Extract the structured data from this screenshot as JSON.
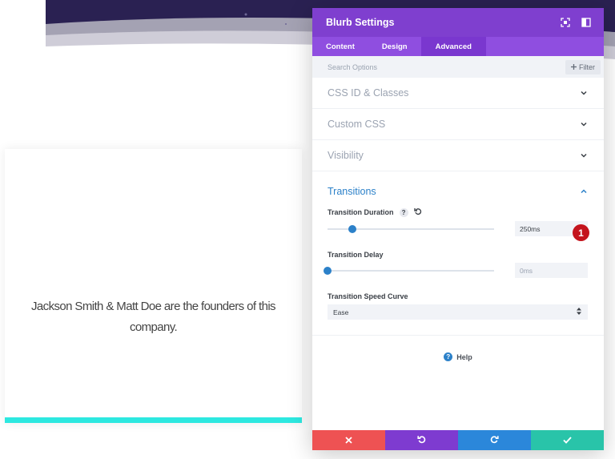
{
  "colors": {
    "header": "#7f3fcf",
    "tab_bar": "#8f4ee0",
    "tab_active": "#7a37cf",
    "accent_blue": "#2c81c9",
    "badge_red": "#c4141d",
    "footer_cancel": "#ee5253",
    "footer_undo": "#7e3bd0",
    "footer_redo": "#2b87da",
    "footer_save": "#29c4a9",
    "blurb_bar": "#2de8e0"
  },
  "background": {
    "blurb_text": "Jackson Smith & Matt Doe are the founders of this company."
  },
  "modal": {
    "title": "Blurb Settings",
    "header_icons": [
      "expand-icon",
      "sidebar-toggle-icon"
    ],
    "tabs": [
      {
        "label": "Content",
        "active": false
      },
      {
        "label": "Design",
        "active": false
      },
      {
        "label": "Advanced",
        "active": true
      }
    ],
    "search": {
      "placeholder": "Search Options",
      "filter_label": "Filter"
    },
    "sections": [
      {
        "label": "CSS ID & Classes",
        "expanded": false
      },
      {
        "label": "Custom CSS",
        "expanded": false
      },
      {
        "label": "Visibility",
        "expanded": false
      }
    ],
    "transitions": {
      "title": "Transitions",
      "expanded": true,
      "duration": {
        "label": "Transition Duration",
        "value": "250ms",
        "slider_fraction": 0.15,
        "badge": "1"
      },
      "delay": {
        "label": "Transition Delay",
        "value": "0ms",
        "slider_fraction": 0.0
      },
      "speed_curve": {
        "label": "Transition Speed Curve",
        "value": "Ease"
      }
    },
    "help_label": "Help",
    "footer_icons": [
      "close-icon",
      "undo-icon",
      "redo-icon",
      "check-icon"
    ]
  }
}
